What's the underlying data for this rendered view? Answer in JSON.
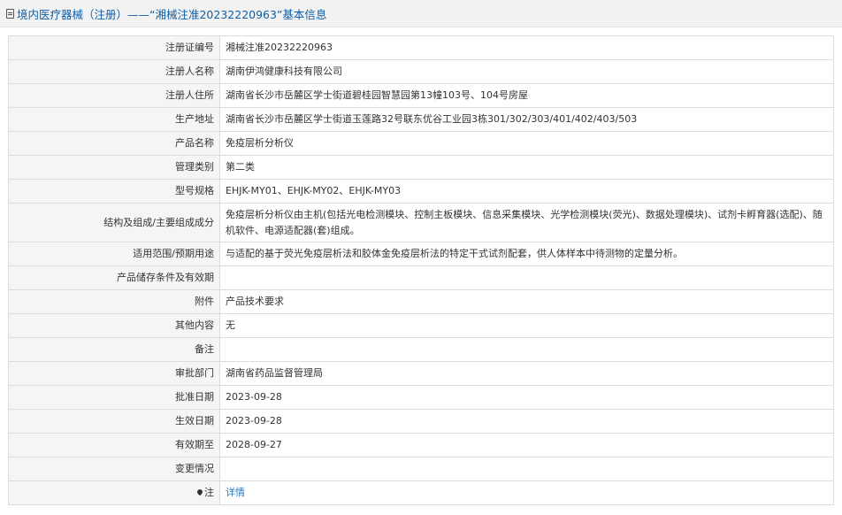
{
  "title": "境内医疗器械（注册）——“湘械注准20232220963”基本信息",
  "rows": [
    {
      "label": "注册证编号",
      "value": "湘械注准20232220963"
    },
    {
      "label": "注册人名称",
      "value": "湖南伊鸿健康科技有限公司"
    },
    {
      "label": "注册人住所",
      "value": "湖南省长沙市岳麓区学士街道碧桂园智慧园第13幢103号、104号房屋"
    },
    {
      "label": "生产地址",
      "value": "湖南省长沙市岳麓区学士街道玉莲路32号联东优谷工业园3栋301/302/303/401/402/403/503"
    },
    {
      "label": "产品名称",
      "value": "免疫层析分析仪"
    },
    {
      "label": "管理类别",
      "value": "第二类"
    },
    {
      "label": "型号规格",
      "value": "EHJK-MY01、EHJK-MY02、EHJK-MY03"
    },
    {
      "label": "结构及组成/主要组成成分",
      "value": "免疫层析分析仪由主机(包括光电检测模块、控制主板模块、信息采集模块、光学检测模块(荧光)、数据处理模块)、试剂卡孵育器(选配)、随机软件、电源适配器(套)组成。"
    },
    {
      "label": "适用范围/预期用途",
      "value": "与适配的基于荧光免疫层析法和胶体金免疫层析法的特定干式试剂配套，供人体样本中待测物的定量分析。"
    },
    {
      "label": "产品储存条件及有效期",
      "value": ""
    },
    {
      "label": "附件",
      "value": "产品技术要求"
    },
    {
      "label": "其他内容",
      "value": "无"
    },
    {
      "label": "备注",
      "value": ""
    },
    {
      "label": "审批部门",
      "value": "湖南省药品监督管理局"
    },
    {
      "label": "批准日期",
      "value": "2023-09-28"
    },
    {
      "label": "生效日期",
      "value": "2023-09-28"
    },
    {
      "label": "有效期至",
      "value": "2028-09-27"
    },
    {
      "label": "变更情况",
      "value": ""
    }
  ],
  "note": {
    "label": "注",
    "link": "详情"
  }
}
